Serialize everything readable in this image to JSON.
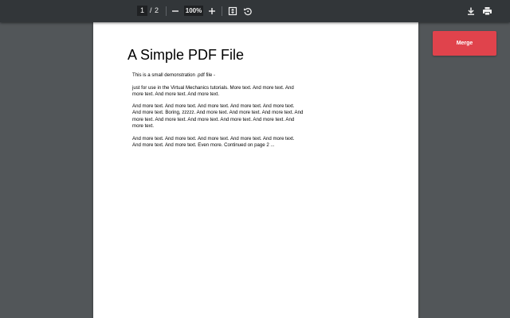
{
  "toolbar": {
    "current_page": "1",
    "page_separator": "/",
    "total_pages": "2",
    "zoom_level": "100%",
    "icons": {
      "zoom_out": "minus-icon",
      "zoom_in": "plus-icon",
      "fit_page": "fit-to-page-icon",
      "rotate": "rotate-counterclockwise-icon",
      "download": "download-icon",
      "print": "print-icon"
    }
  },
  "side_panel": {
    "merge_label": "Merge",
    "merge_color": "#e0434c"
  },
  "document": {
    "title": "A Simple PDF File",
    "paragraphs": [
      "This is a small demonstration .pdf file -",
      "just for use in the Virtual Mechanics tutorials. More text. And more text. And more text. And more text. And more text.",
      "And more text. And more text. And more text. And more text. And more text. And more text. Boring, zzzzz. And more text. And more text. And more text. And more text. And more text. And more text. And more text. And more text. And more text.",
      "And more text. And more text. And more text. And more text. And more text. And more text. And more text. Even more. Continued on page 2 ..."
    ]
  },
  "colors": {
    "toolbar_bg": "#323639",
    "viewer_bg": "#525659",
    "page_bg": "#ffffff"
  }
}
